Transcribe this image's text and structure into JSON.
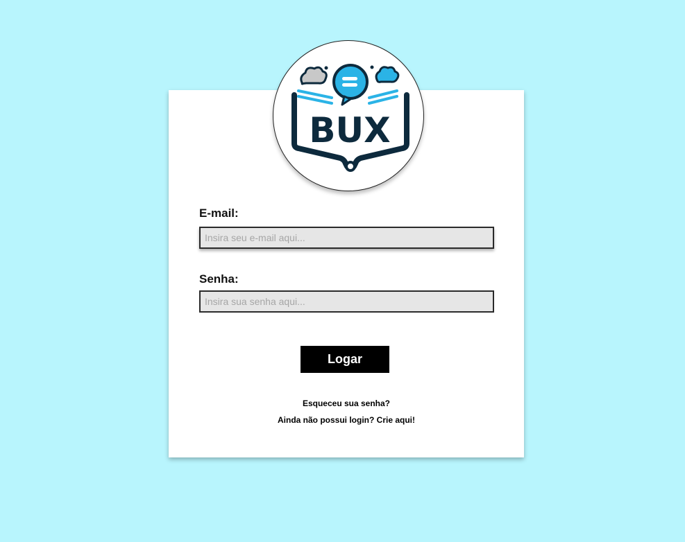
{
  "logo": {
    "text": "BUX",
    "colors": {
      "outline": "#0d2a3d",
      "accent": "#2bb3e6",
      "gray": "#c8c8c8"
    }
  },
  "form": {
    "email": {
      "label": "E-mail:",
      "placeholder": "Insira seu e-mail aqui...",
      "value": ""
    },
    "password": {
      "label": "Senha:",
      "placeholder": "Insira sua senha aqui...",
      "value": ""
    },
    "submit_label": "Logar"
  },
  "links": {
    "forgot_password": "Esqueceu sua senha?",
    "create_account": "Ainda não possui login? Crie aqui!"
  },
  "colors": {
    "background": "#b8f5fd",
    "card": "#ffffff",
    "input_bg": "#e6e6e6",
    "button_bg": "#000000",
    "button_text": "#ffffff"
  }
}
